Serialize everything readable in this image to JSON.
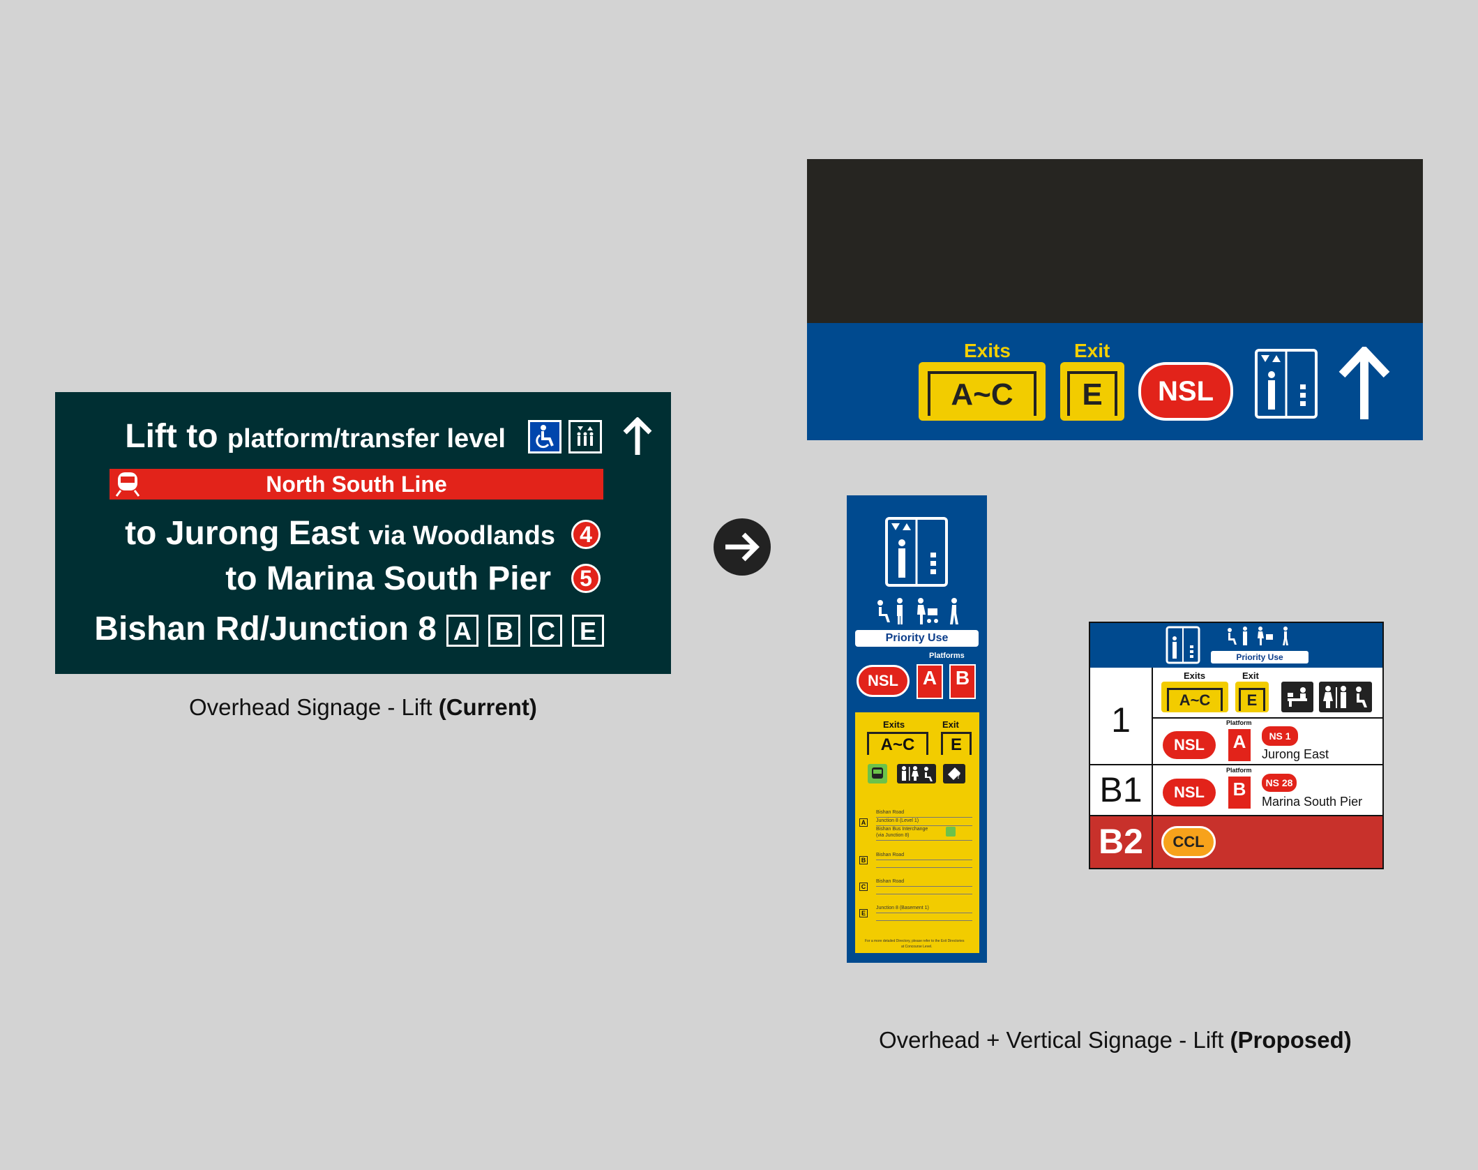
{
  "current": {
    "lift_to": "Lift to",
    "platform_level": "platform/transfer level",
    "line_name": "North South Line",
    "dest1_to": "to Jurong East",
    "dest1_via": "via Woodlands",
    "dest1_num": "4",
    "dest2": "to Marina South Pier",
    "dest2_num": "5",
    "street": "Bishan Rd/Junction 8",
    "exits": [
      "A",
      "B",
      "C",
      "E"
    ],
    "caption_main": "Overhead Signage - Lift ",
    "caption_bold": "(Current)"
  },
  "proposed_overhead": {
    "exits_label": "Exits",
    "exits_value": "A~C",
    "exit_label": "Exit",
    "exit_value": "E",
    "line": "NSL"
  },
  "vertical": {
    "priority": "Priority Use",
    "platforms_label": "Platforms",
    "line": "NSL",
    "platform_a": "A",
    "platform_b": "B",
    "exits_label": "Exits",
    "exits_value": "A~C",
    "exit_label": "Exit",
    "exit_value": "E",
    "directory": [
      {
        "code": "A",
        "lines": [
          "Bishan Road",
          "Junction 8 (Level 1)",
          "Bishan Bus Interchange",
          "(via Junction 8)"
        ]
      },
      {
        "code": "B",
        "lines": [
          "Bishan Road"
        ]
      },
      {
        "code": "C",
        "lines": [
          "Bishan Road"
        ]
      },
      {
        "code": "E",
        "lines": [
          "Junction 8 (Basement 1)"
        ]
      }
    ],
    "footnote1": "For a more detailed Directory, please refer to the Exit Directories",
    "footnote2": "at Concourse Level."
  },
  "directory_sign": {
    "priority": "Priority Use",
    "exits_label": "Exits",
    "exits_value": "A~C",
    "exit_label": "Exit",
    "exit_value": "E",
    "rows": [
      {
        "level": "1",
        "line": "NSL",
        "platform_label": "Platform",
        "platform": "A",
        "code": "NS 1",
        "dest": "Jurong East"
      },
      {
        "level": "B1",
        "line": "NSL",
        "platform_label": "Platform",
        "platform": "B",
        "code": "NS 28",
        "dest": "Marina South Pier"
      },
      {
        "level": "B2",
        "line": "CCL"
      }
    ]
  },
  "caption_proposed_main": "Overhead + Vertical Signage - Lift ",
  "caption_proposed_bold": "(Proposed)",
  "colors": {
    "current_bg": "#002f33",
    "nsl_red": "#e2231a",
    "overhead_blue": "#004a8f",
    "exit_yellow": "#f2cc00",
    "ccl_orange": "#f7a21b",
    "b2_red": "#c8312b"
  }
}
